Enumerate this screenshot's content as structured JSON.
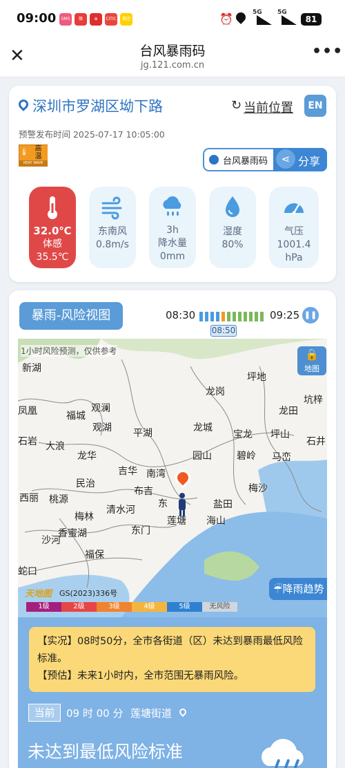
{
  "statusbar": {
    "time": "09:00",
    "app_icons": [
      {
        "icon": "app-shortcut-icon",
        "color": "#f05a7e",
        "text": "SMS"
      },
      {
        "icon": "app-shortcut-icon",
        "color": "#e83b3b",
        "text": "微"
      },
      {
        "icon": "app-shortcut-icon",
        "color": "#e02d2d",
        "text": "⊕"
      },
      {
        "icon": "app-shortcut-icon",
        "color": "#e8463b",
        "text": "CITIC"
      },
      {
        "icon": "app-shortcut-icon",
        "color": "#ffd000",
        "text": "美团"
      }
    ],
    "signal1": "5G",
    "signal2": "5G",
    "battery": "81"
  },
  "titlebar": {
    "title": "台风暴雨码",
    "url": "jg.121.com.cn"
  },
  "location": {
    "address": "深圳市罗湖区坳下路",
    "current_position_label": "当前位置",
    "lang_button": "EN",
    "issue_time": "预警发布时间 2025-07-17 10:05:00"
  },
  "warning_badge": {
    "text_top": "高",
    "text_bottom": "温",
    "caption": "HEAT WAVE",
    "color": "#f39a21"
  },
  "share": {
    "code_label": "台风暴雨码",
    "share_label": "分享"
  },
  "metrics": [
    {
      "icon": "thermometer-icon",
      "line1": "32.0℃",
      "line2": "体感",
      "line3": "35.5℃",
      "highlight": true
    },
    {
      "icon": "wind-icon",
      "line1": "东南风",
      "line2": "0.8m/s",
      "line3": ""
    },
    {
      "icon": "rain-cloud-icon",
      "line1": "3h",
      "line2": "降水量",
      "line3": "0mm"
    },
    {
      "icon": "humidity-drop-icon",
      "line1": "湿度",
      "line2": "80%",
      "line3": ""
    },
    {
      "icon": "pressure-gauge-icon",
      "line1": "气压",
      "line2": "1001.4",
      "line3": "hPa"
    }
  ],
  "risk_map": {
    "title": "暴雨-风险视图",
    "start_time": "08:30",
    "end_time": "09:25",
    "current_time": "08:50",
    "map_note": "1小时风险预测，仅供参考",
    "map_button": "地图",
    "trend_button": "降雨趋势",
    "copyright": "GS(2023)336号",
    "map_brand": "天地图",
    "place_labels": [
      "新湖",
      "坪地",
      "龙岗",
      "坑梓",
      "凤凰",
      "福城",
      "观澜",
      "龙田",
      "观湖",
      "平湖",
      "龙城",
      "宝龙",
      "坪山",
      "石岩",
      "大浪",
      "石井",
      "龙华",
      "园山",
      "碧岭",
      "马峦",
      "吉华",
      "南湾",
      "民治",
      "布吉",
      "东",
      "西丽",
      "桃源",
      "梅沙",
      "盐田",
      "梅林",
      "清水河",
      "莲塘",
      "海山",
      "香蜜湖",
      "东门",
      "沙河",
      "福保",
      "蛇口"
    ],
    "legend": [
      {
        "label": "1级",
        "color": "#a4207e"
      },
      {
        "label": "2级",
        "color": "#e64646"
      },
      {
        "label": "3级",
        "color": "#f0832d"
      },
      {
        "label": "4级",
        "color": "#f4b53e"
      },
      {
        "label": "5级",
        "color": "#2f80d1"
      },
      {
        "label": "无风险",
        "color": "#cfd6de"
      }
    ]
  },
  "notice": {
    "actual": "【实况】08时50分，全市各街道（区）未达到暴雨最低风险标准。",
    "forecast": "【预估】未来1小时内，全市范围无暴雨风险。"
  },
  "current": {
    "tag": "当前",
    "time": "09 时 00 分",
    "street": "莲塘街道",
    "status": "未达到最低风险标准"
  }
}
